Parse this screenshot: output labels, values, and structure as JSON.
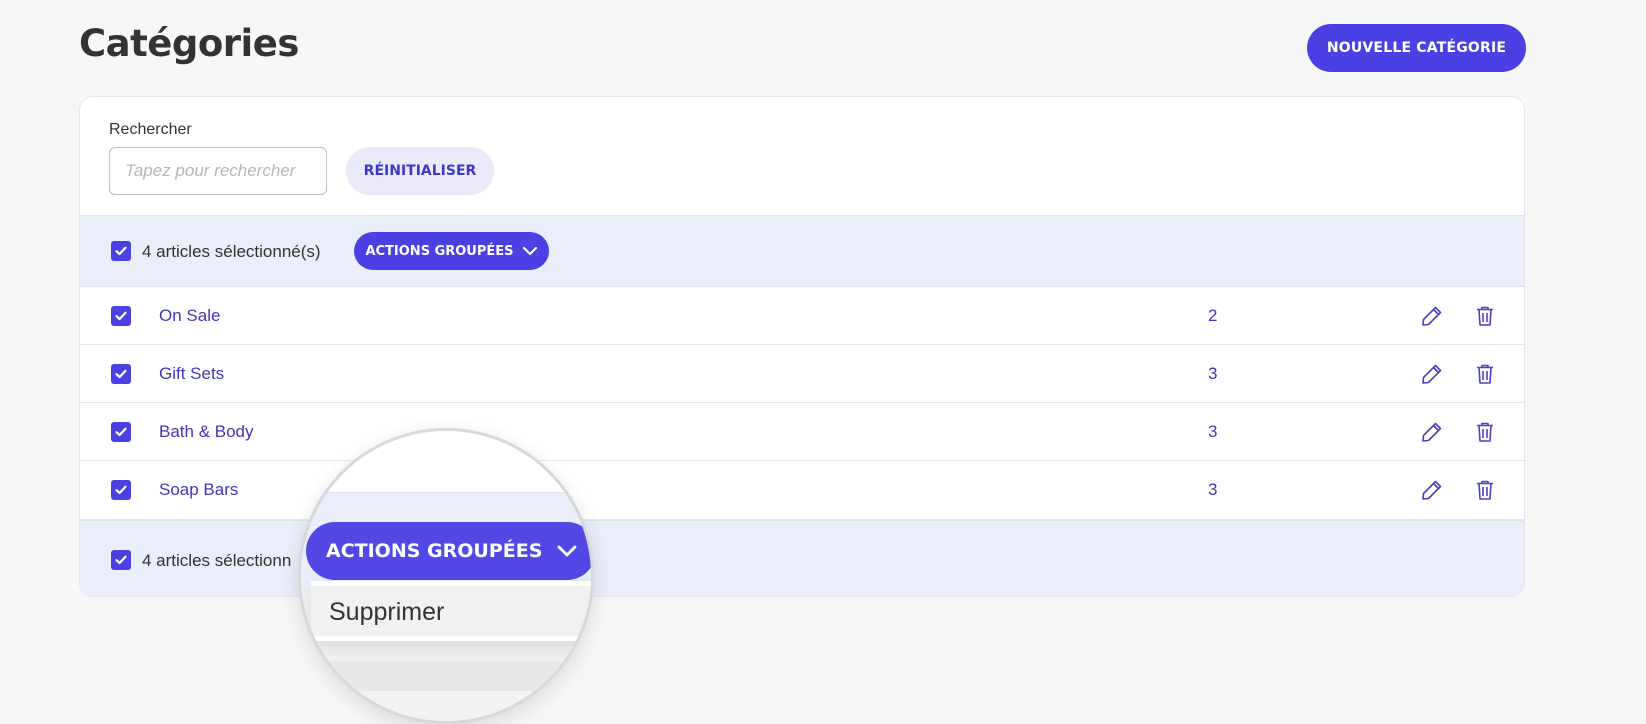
{
  "header": {
    "title": "Catégories",
    "new_button_label": "NOUVELLE CATÉGORIE"
  },
  "filters": {
    "search_label": "Rechercher",
    "search_placeholder": "Tapez pour rechercher",
    "search_value": "",
    "reset_label": "RÉINITIALISER"
  },
  "bulk": {
    "selected_text": "4 articles sélectionné(s)",
    "selected_text_truncated": "4 articles sélectionn",
    "actions_label": "ACTIONS GROUPÉES",
    "menu_items": [
      "Supprimer"
    ]
  },
  "rows": [
    {
      "name": "On Sale",
      "count": "2"
    },
    {
      "name": "Gift Sets",
      "count": "3"
    },
    {
      "name": "Bath & Body",
      "count": "3"
    },
    {
      "name": "Soap Bars",
      "count": "3"
    }
  ],
  "icons": {
    "checkbox": "checkmark-icon",
    "edit": "pencil-icon",
    "delete": "trash-icon",
    "dropdown": "chevron-down-icon"
  },
  "colors": {
    "accent": "#4a40e3",
    "link": "#3f37b8",
    "bulk_bg": "#e9eefa"
  }
}
